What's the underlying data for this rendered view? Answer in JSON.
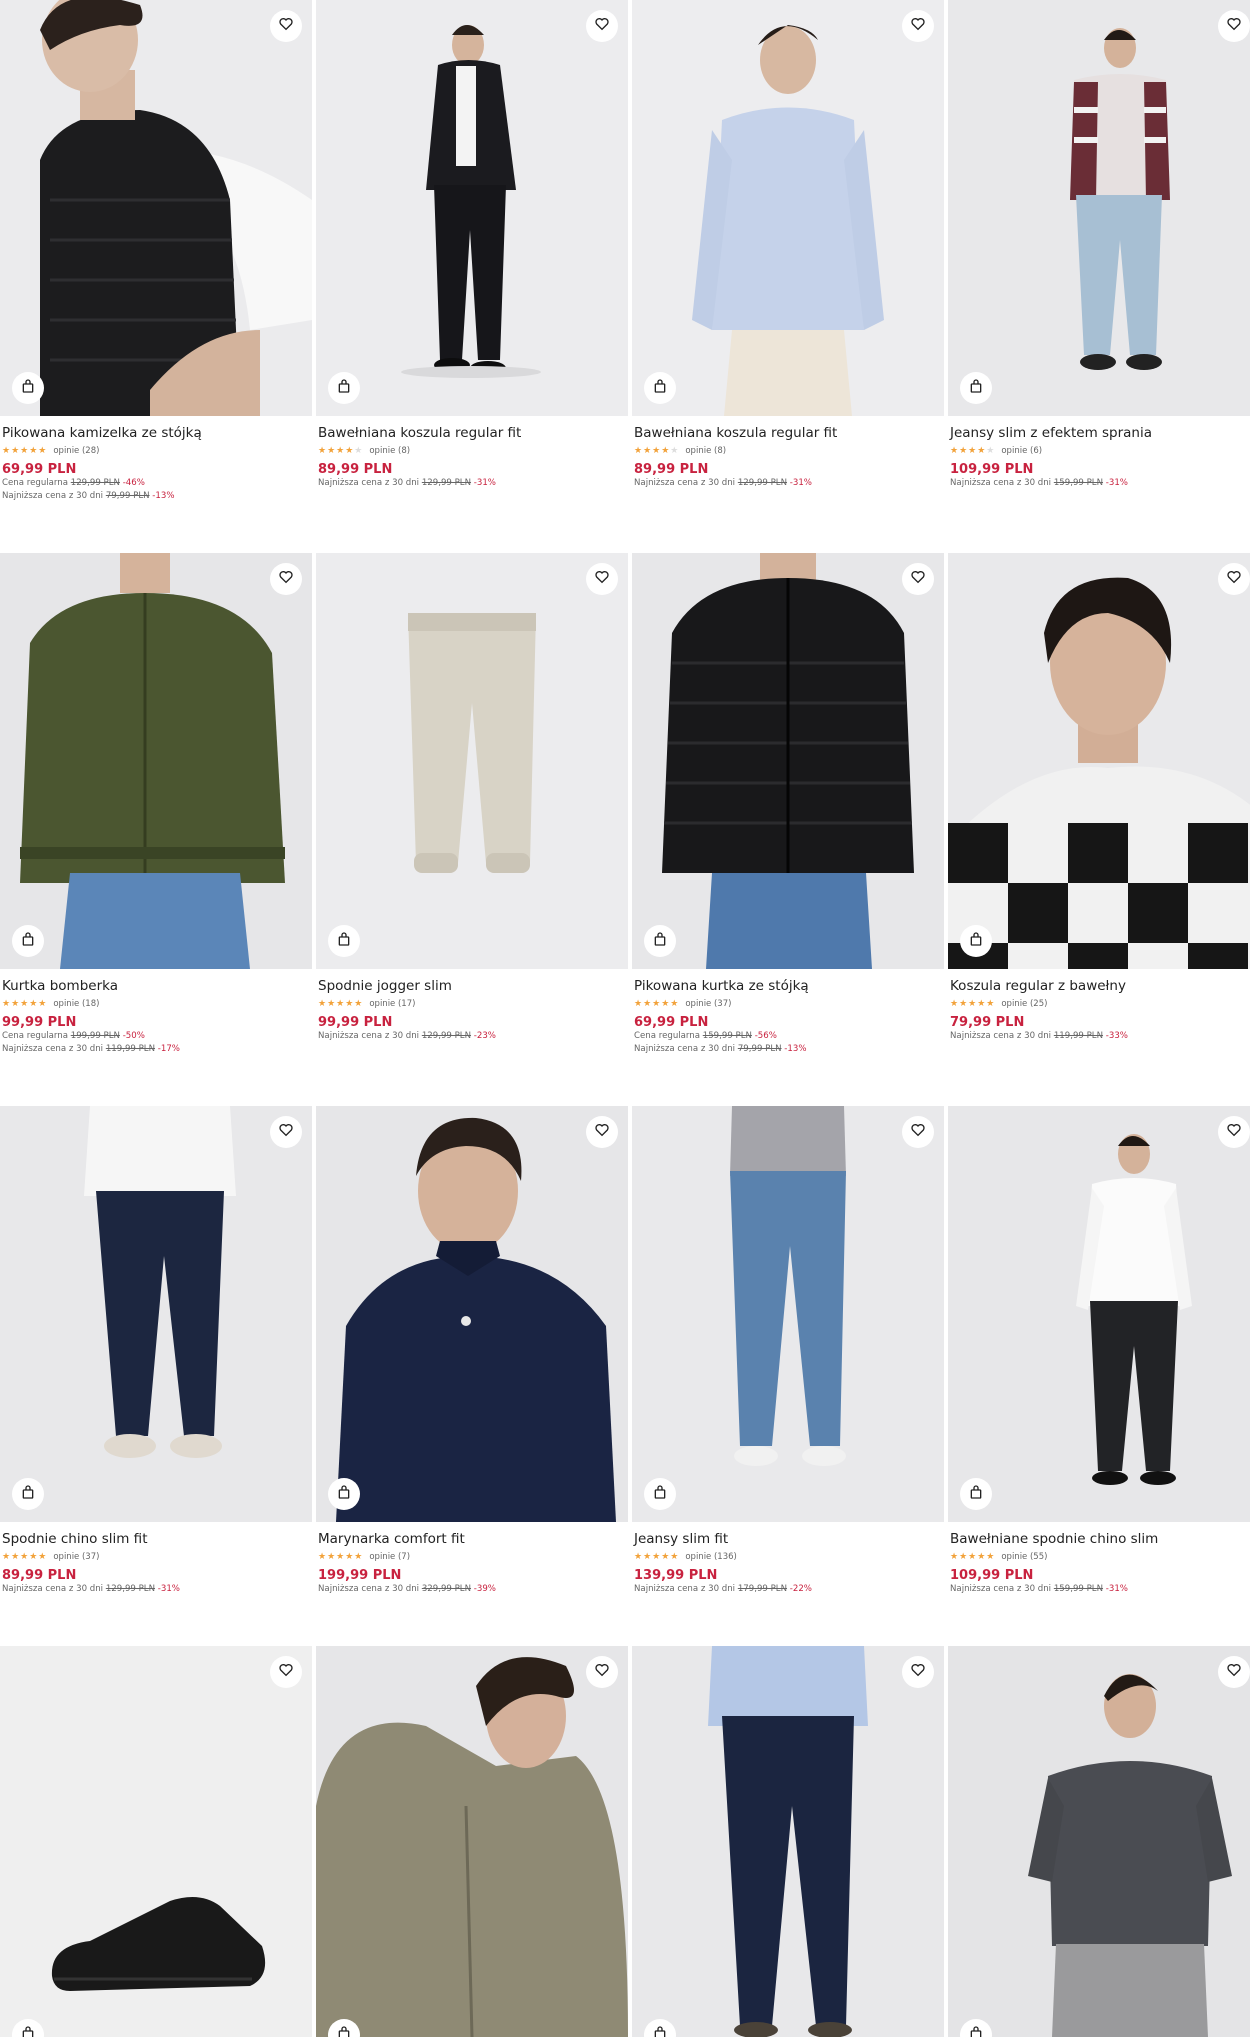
{
  "products": [
    {
      "name": "Pikowana kamizelka ze stójką",
      "stars": 5,
      "reviews": "opinie (28)",
      "price": "69,99 PLN",
      "lines": [
        {
          "label": "Cena regularna",
          "old": "129,99 PLN",
          "pct": "-46%"
        },
        {
          "label": "Najniższa cena z 30 dni",
          "old": "79,99 PLN",
          "pct": "-13%"
        }
      ],
      "image": "man-black-quilted-vest"
    },
    {
      "name": "Bawełniana koszula regular fit",
      "stars": 4.5,
      "reviews": "opinie (8)",
      "price": "89,99 PLN",
      "lines": [
        {
          "label": "Najniższa cena z 30 dni",
          "old": "129,99 PLN",
          "pct": "-31%"
        }
      ],
      "image": "man-black-shirt"
    },
    {
      "name": "Bawełniana koszula regular fit",
      "stars": 4.5,
      "reviews": "opinie (8)",
      "price": "89,99 PLN",
      "lines": [
        {
          "label": "Najniższa cena z 30 dni",
          "old": "129,99 PLN",
          "pct": "-31%"
        }
      ],
      "image": "man-light-blue-shirt"
    },
    {
      "name": "Jeansy slim z efektem sprania",
      "stars": 4,
      "reviews": "opinie (6)",
      "price": "109,99 PLN",
      "lines": [
        {
          "label": "Najniższa cena z 30 dni",
          "old": "159,99 PLN",
          "pct": "-31%"
        }
      ],
      "image": "man-light-jeans-check-shirt"
    },
    {
      "name": "Kurtka bomberka",
      "stars": 5,
      "reviews": "opinie (18)",
      "price": "99,99 PLN",
      "lines": [
        {
          "label": "Cena regularna",
          "old": "199,99 PLN",
          "pct": "-50%"
        },
        {
          "label": "Najniższa cena z 30 dni",
          "old": "119,99 PLN",
          "pct": "-17%"
        }
      ],
      "image": "man-olive-bomber"
    },
    {
      "name": "Spodnie jogger slim",
      "stars": 5,
      "reviews": "opinie (17)",
      "price": "99,99 PLN",
      "lines": [
        {
          "label": "Najniższa cena z 30 dni",
          "old": "129,99 PLN",
          "pct": "-23%"
        }
      ],
      "image": "beige-jogger-pants"
    },
    {
      "name": "Pikowana kurtka ze stójką",
      "stars": 5,
      "reviews": "opinie (37)",
      "price": "69,99 PLN",
      "lines": [
        {
          "label": "Cena regularna",
          "old": "159,99 PLN",
          "pct": "-56%"
        },
        {
          "label": "Najniższa cena z 30 dni",
          "old": "79,99 PLN",
          "pct": "-13%"
        }
      ],
      "image": "man-black-quilted-jacket"
    },
    {
      "name": "Koszula regular z bawełny",
      "stars": 5,
      "reviews": "opinie (25)",
      "price": "79,99 PLN",
      "lines": [
        {
          "label": "Najniższa cena z 30 dni",
          "old": "119,99 PLN",
          "pct": "-33%"
        }
      ],
      "image": "man-check-shirt-portrait"
    },
    {
      "name": "Spodnie chino slim fit",
      "stars": 5,
      "reviews": "opinie (37)",
      "price": "89,99 PLN",
      "lines": [
        {
          "label": "Najniższa cena z 30 dni",
          "old": "129,99 PLN",
          "pct": "-31%"
        }
      ],
      "image": "navy-chino-pants"
    },
    {
      "name": "Marynarka comfort fit",
      "stars": 5,
      "reviews": "opinie (7)",
      "price": "199,99 PLN",
      "lines": [
        {
          "label": "Najniższa cena z 30 dni",
          "old": "329,99 PLN",
          "pct": "-39%"
        }
      ],
      "image": "man-navy-jacket"
    },
    {
      "name": "Jeansy slim fit",
      "stars": 5,
      "reviews": "opinie (136)",
      "price": "139,99 PLN",
      "lines": [
        {
          "label": "Najniższa cena z 30 dni",
          "old": "179,99 PLN",
          "pct": "-22%"
        }
      ],
      "image": "blue-slim-jeans"
    },
    {
      "name": "Bawełniane spodnie chino slim",
      "stars": 5,
      "reviews": "opinie (55)",
      "price": "109,99 PLN",
      "lines": [
        {
          "label": "Najniższa cena z 30 dni",
          "old": "159,99 PLN",
          "pct": "-31%"
        }
      ],
      "image": "man-white-shirt-black-chinos"
    },
    {
      "name": "",
      "stars": 0,
      "reviews": "",
      "price": "",
      "lines": [],
      "image": "black-leather-sneaker"
    },
    {
      "name": "",
      "stars": 0,
      "reviews": "",
      "price": "",
      "lines": [],
      "image": "man-khaki-hooded-jacket"
    },
    {
      "name": "",
      "stars": 0,
      "reviews": "",
      "price": "",
      "lines": [],
      "image": "navy-trousers-blue-shirt"
    },
    {
      "name": "",
      "stars": 0,
      "reviews": "",
      "price": "",
      "lines": [],
      "image": "man-grey-tshirt"
    }
  ],
  "icons": {
    "favorite": "heart-icon",
    "cart": "shopping-bag-icon"
  },
  "colors": {
    "price": "#c8223f",
    "star": "#f2a23a"
  }
}
